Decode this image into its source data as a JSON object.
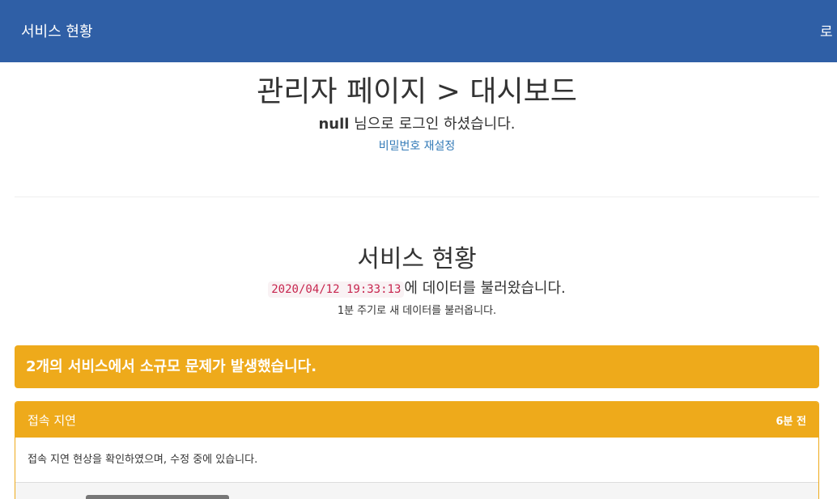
{
  "navbar": {
    "brand": "서비스 현황",
    "logout_label": "로"
  },
  "header": {
    "title": "관리자 페이지 > 대시보드",
    "user_name": "null",
    "login_suffix": " 님으로 로그인 하셨습니다.",
    "reset_password_link": "비밀번호 재설정"
  },
  "status": {
    "title": "서비스 현황",
    "loaded_at": "2020/04/12 19:33:13",
    "loaded_suffix": "에 데이터를 불러왔습니다.",
    "refresh_note": "1분 주기로 새 데이터를 불러옵니다."
  },
  "alert": {
    "message": "2개의 서비스에서 소규모 문제가 발생했습니다.",
    "level": "warning"
  },
  "incidents": [
    {
      "title": "접속 지연",
      "time_ago": "6분 전",
      "description": "접속 지연 현상을 확인하였으며, 수정 중에 있습니다."
    }
  ],
  "colors": {
    "navbar": "#2f5fa6",
    "warning": "#eeaa1b",
    "link": "#337ab7",
    "code_text": "#c7254e",
    "code_background": "#f9f2f4"
  }
}
